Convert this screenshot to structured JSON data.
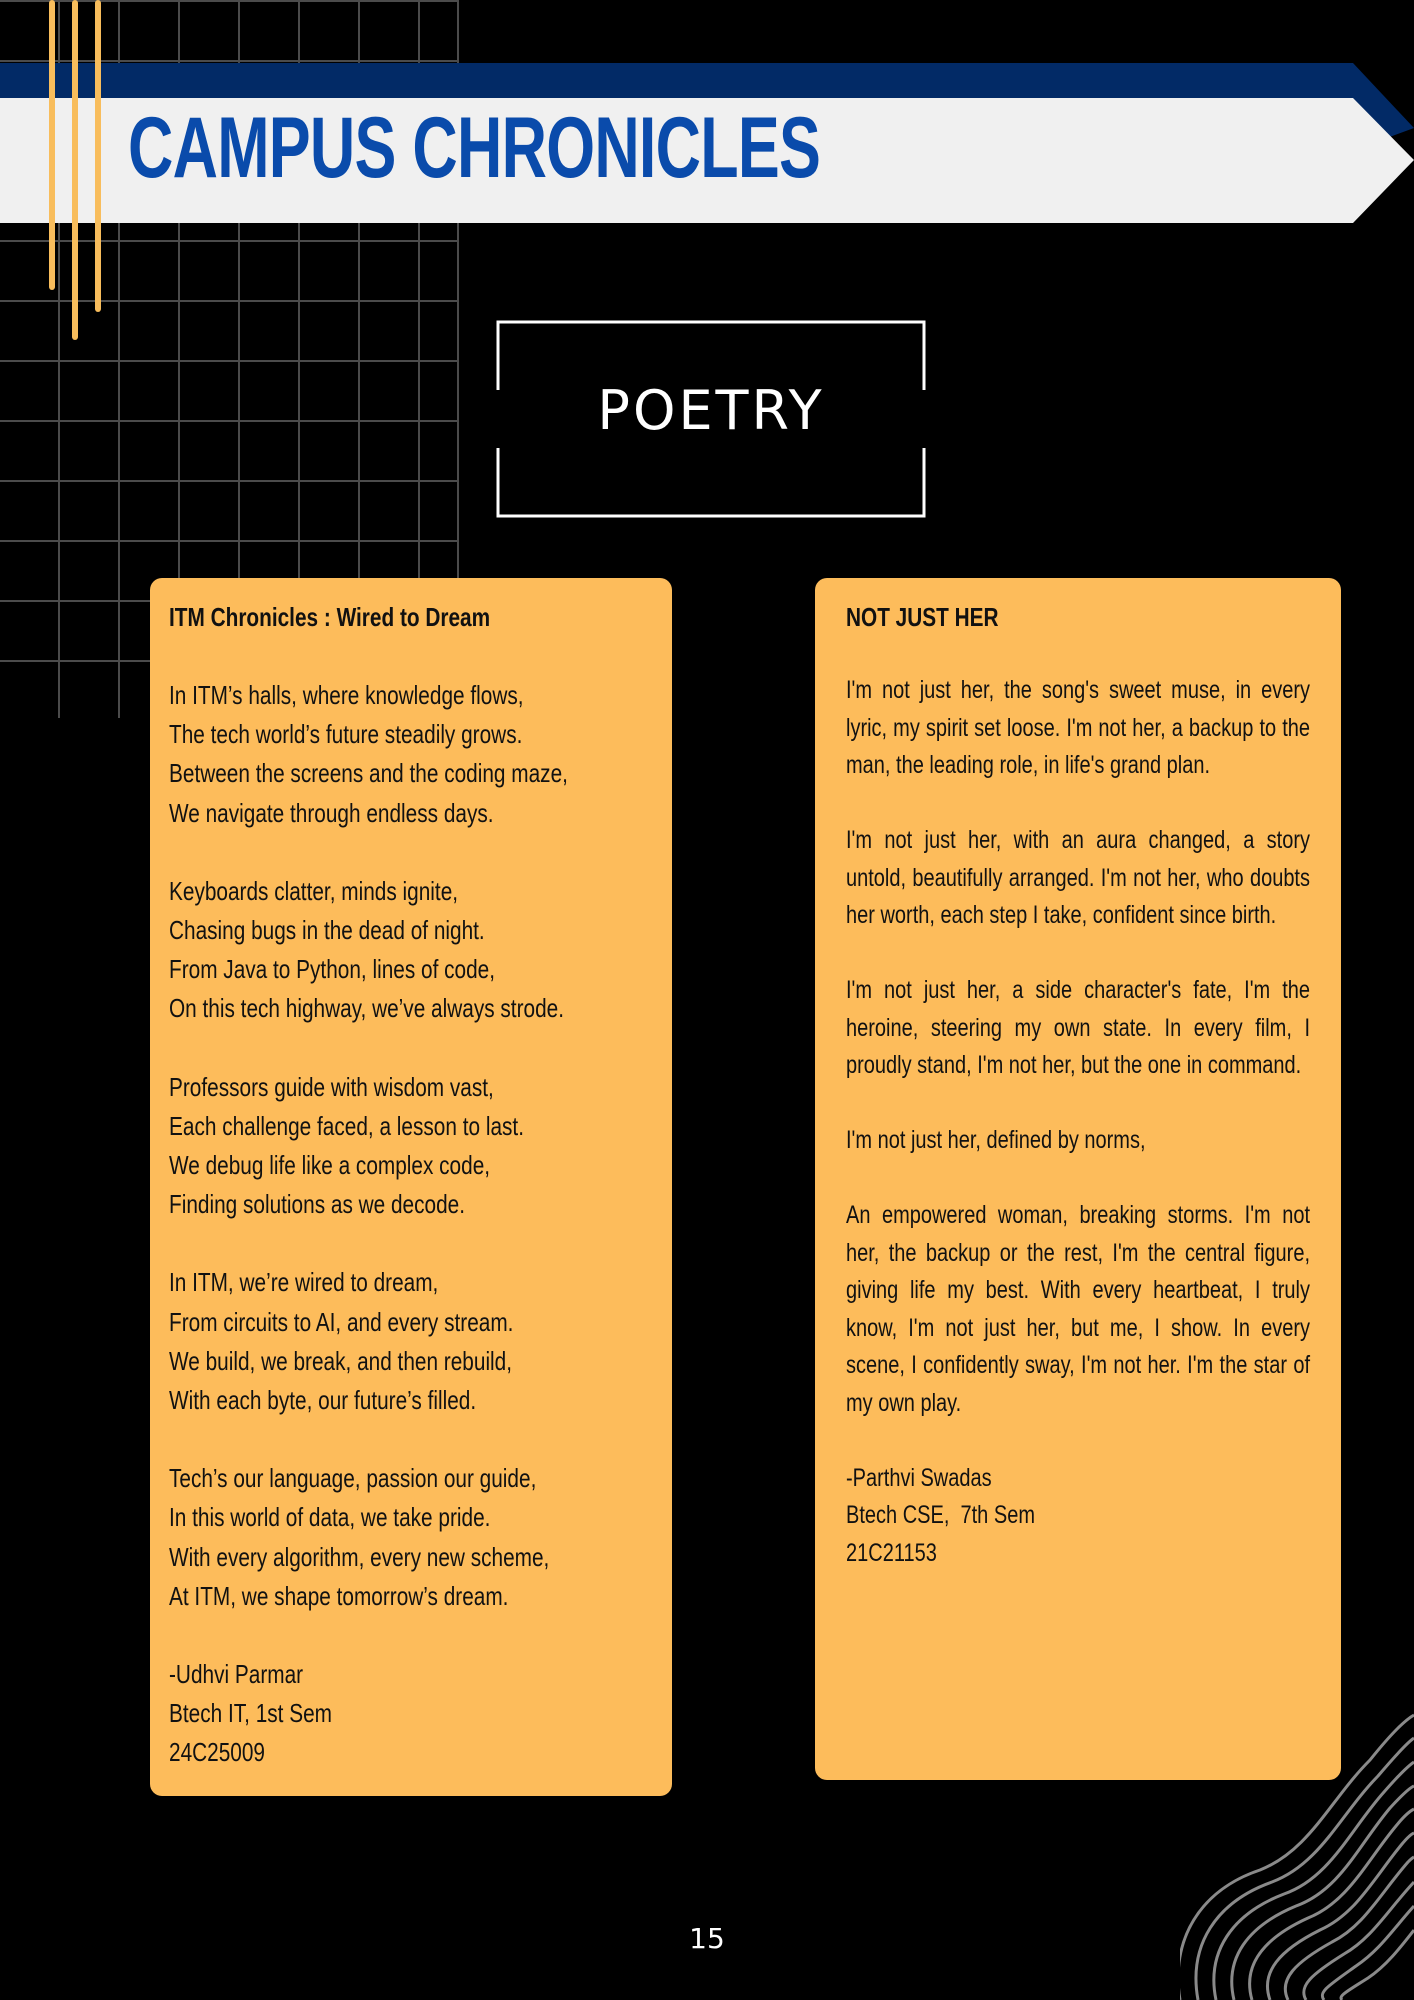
{
  "header": {
    "title": "CAMPUS CHRONICLES"
  },
  "section": {
    "label": "POETRY"
  },
  "colors": {
    "background": "#000000",
    "accent_yellow": "#fdbc5b",
    "title_blue": "#0a4bab",
    "ribbon_navy": "#022a66",
    "ribbon_light": "#f0f0f0"
  },
  "poems": [
    {
      "title": "ITM Chronicles : Wired to Dream",
      "stanzas": [
        [
          "In ITM’s halls, where knowledge flows,",
          "The tech world’s future steadily grows.",
          "Between the screens and the coding maze,",
          "We navigate through endless days."
        ],
        [
          "Keyboards clatter, minds ignite,",
          "Chasing bugs in the dead of night.",
          "From Java to Python, lines of code,",
          "On this tech highway, we’ve always strode."
        ],
        [
          "Professors guide with wisdom vast,",
          "Each challenge faced, a lesson to last.",
          "We debug life like a complex code,",
          "Finding solutions as we decode."
        ],
        [
          "In ITM, we’re wired to dream,",
          "From circuits to AI, and every stream.",
          "We build, we break, and then rebuild,",
          "With each byte, our future’s filled."
        ],
        [
          "Tech’s our language, passion our guide,",
          "In this world of data, we take pride.",
          "With every algorithm, every new scheme,",
          "At ITM, we shape tomorrow’s dream."
        ]
      ],
      "signature": [
        "-Udhvi Parmar",
        "Btech IT, 1st Sem",
        "24C25009"
      ]
    },
    {
      "title": "NOT JUST HER",
      "paragraphs": [
        "I'm not just her, the song's sweet muse, in every lyric, my spirit set loose. I'm not her, a backup to the man, the leading role, in life's grand plan.",
        "I'm not just her, with an aura changed, a story untold, beautifully arranged. I'm not her, who doubts her worth, each step I take, confident since birth.",
        "I'm not just her, a side character's fate, I'm the heroine, steering my own state. In every film, I proudly stand, I'm not her, but the one in command.",
        "I'm not just her, defined by norms,",
        "An empowered woman, breaking storms. I'm not her, the backup or the rest, I'm the central figure, giving life my best. With every heartbeat, I truly know, I'm not just her, but me, I show. In every scene, I confidently sway, I'm not her. I'm the star of my own play."
      ],
      "signature": [
        "-Parthvi Swadas",
        "Btech CSE,  7th Sem",
        "21C21153"
      ]
    }
  ],
  "footer": {
    "page_number": "15"
  }
}
